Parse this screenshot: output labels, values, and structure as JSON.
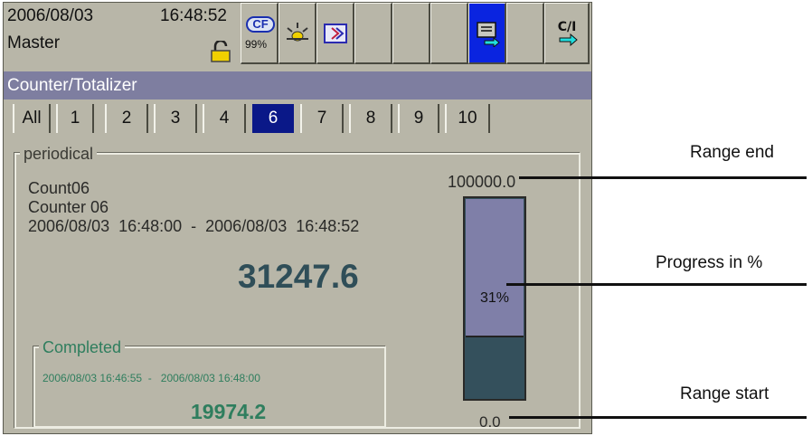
{
  "status": {
    "date": "2006/08/03",
    "time": "16:48:52",
    "role": "Master",
    "cf_label": "CF",
    "cf_usage": "99%",
    "buttons": [
      "cf-card-button",
      "alarm-button",
      "message-button",
      "blank-button",
      "blank-button",
      "logout-button",
      "blank-button",
      "user-login-button"
    ],
    "active_color": "#0a24e0",
    "login_label": "C/I"
  },
  "title": "Counter/Totalizer",
  "tabs": [
    {
      "label": "All",
      "active": false
    },
    {
      "label": "1",
      "active": false
    },
    {
      "label": "2",
      "active": false
    },
    {
      "label": "3",
      "active": false
    },
    {
      "label": "4",
      "active": false
    },
    {
      "label": "6",
      "active": true
    },
    {
      "label": "7",
      "active": false
    },
    {
      "label": "8",
      "active": false
    },
    {
      "label": "9",
      "active": false
    },
    {
      "label": "10",
      "active": false
    }
  ],
  "periodical": {
    "legend": "periodical",
    "tag": "Count06",
    "name": "Counter 06",
    "period": "2006/08/03  16:48:00  -  2006/08/03  16:48:52",
    "value": "31247.6",
    "range_end": "100000.0",
    "range_start": "0.0",
    "progress_percent": 31,
    "progress_label": "31%",
    "completed": {
      "legend": "Completed",
      "period": "2006/08/03 16:46:55  -   2006/08/03 16:48:00",
      "value": "19974.2"
    }
  },
  "annotations": {
    "range_end": "Range end",
    "progress": "Progress in %",
    "range_start": "Range start"
  }
}
